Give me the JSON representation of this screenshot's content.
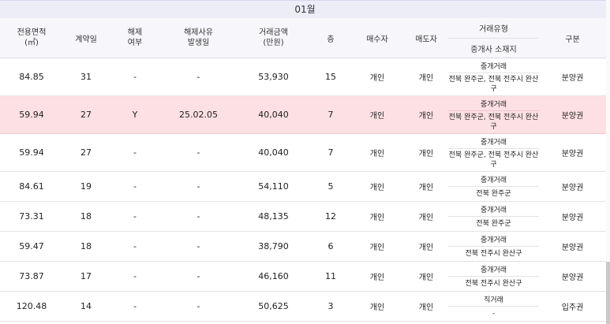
{
  "month": "01월",
  "headers": {
    "area": [
      "전용면적",
      "(㎡)"
    ],
    "contract_day": "계약일",
    "cancel": [
      "해제",
      "여부"
    ],
    "cancel_date": [
      "해제사유",
      "발생일"
    ],
    "price": [
      "거래금액",
      "(만원)"
    ],
    "floor": "층",
    "buyer": "매수자",
    "seller": "매도자",
    "deal_type": "거래유형",
    "agent_location": "중개사 소재지",
    "category": "구분"
  },
  "rows": [
    {
      "area": "84.85",
      "day": "31",
      "cancel": "-",
      "cancel_date": "-",
      "price": "53,930",
      "floor": "15",
      "buyer": "개인",
      "seller": "개인",
      "type": "중개거래",
      "office": "전북 완주군, 전북 전주시 완산구",
      "category": "분양권"
    },
    {
      "area": "59.94",
      "day": "27",
      "cancel": "Y",
      "cancel_date": "25.02.05",
      "price": "40,040",
      "floor": "7",
      "buyer": "개인",
      "seller": "개인",
      "type": "중개거래",
      "office": "전북 완주군, 전북 전주시 완산구",
      "category": "분양권"
    },
    {
      "area": "59.94",
      "day": "27",
      "cancel": "-",
      "cancel_date": "-",
      "price": "40,040",
      "floor": "7",
      "buyer": "개인",
      "seller": "개인",
      "type": "중개거래",
      "office": "전북 완주군, 전북 전주시 완산구",
      "category": "분양권"
    },
    {
      "area": "84.61",
      "day": "19",
      "cancel": "-",
      "cancel_date": "-",
      "price": "54,110",
      "floor": "5",
      "buyer": "개인",
      "seller": "개인",
      "type": "중개거래",
      "office": "전북 완주군",
      "category": "분양권"
    },
    {
      "area": "73.31",
      "day": "18",
      "cancel": "-",
      "cancel_date": "-",
      "price": "48,135",
      "floor": "12",
      "buyer": "개인",
      "seller": "개인",
      "type": "중개거래",
      "office": "전북 완주군",
      "category": "분양권"
    },
    {
      "area": "59.47",
      "day": "18",
      "cancel": "-",
      "cancel_date": "-",
      "price": "38,790",
      "floor": "6",
      "buyer": "개인",
      "seller": "개인",
      "type": "중개거래",
      "office": "전북 전주시 완산구",
      "category": "분양권"
    },
    {
      "area": "73.87",
      "day": "17",
      "cancel": "-",
      "cancel_date": "-",
      "price": "46,160",
      "floor": "11",
      "buyer": "개인",
      "seller": "개인",
      "type": "중개거래",
      "office": "전북 전주시 완산구",
      "category": "분양권"
    },
    {
      "area": "120.48",
      "day": "14",
      "cancel": "-",
      "cancel_date": "-",
      "price": "50,625",
      "floor": "3",
      "buyer": "개인",
      "seller": "개인",
      "type": "직거래",
      "office": "-",
      "category": "입주권"
    }
  ],
  "colors": {
    "highlight": "#fde0e3",
    "header_bg": "#f7f7fb",
    "month_bg": "#ecedf7"
  }
}
